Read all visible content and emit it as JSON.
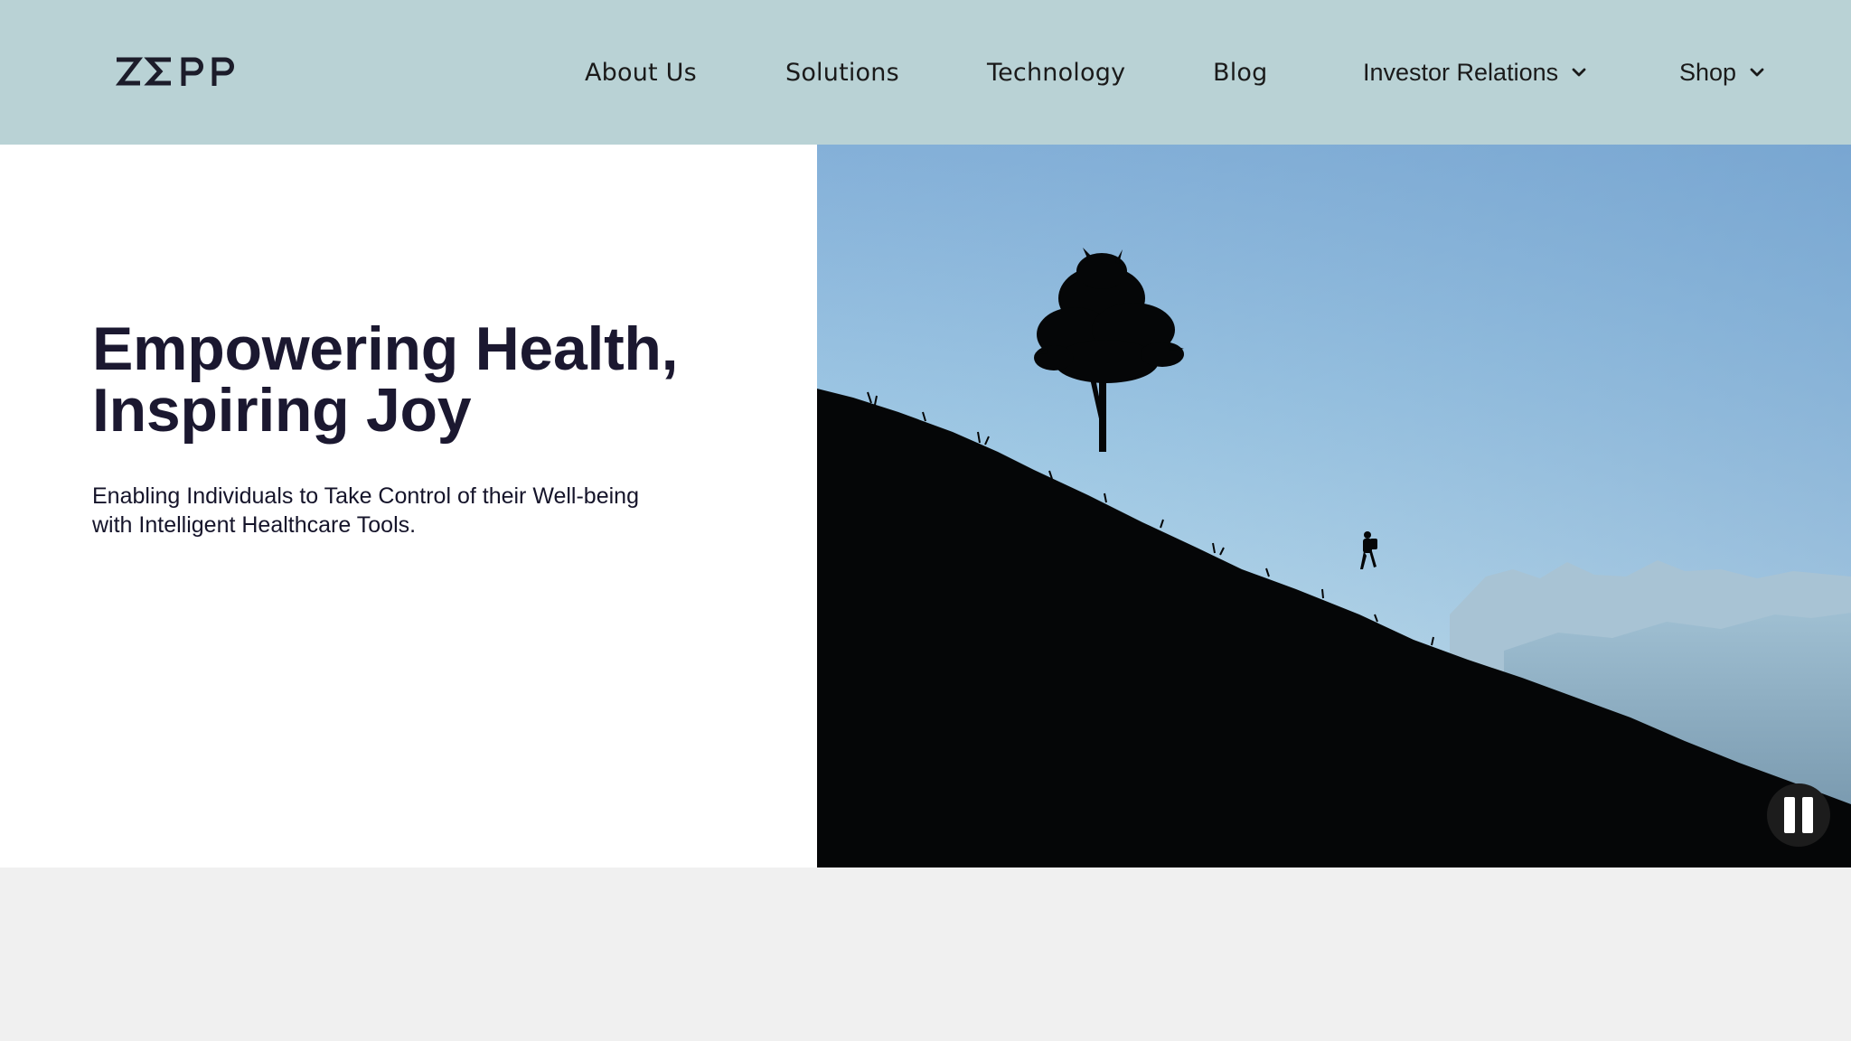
{
  "header": {
    "logo_text": "ZΣPP",
    "nav": [
      {
        "label": "About Us",
        "icon": null
      },
      {
        "label": "Solutions",
        "icon": null
      },
      {
        "label": "Technology",
        "icon": null
      },
      {
        "label": "Blog",
        "icon": null
      },
      {
        "label": "Investor Relations",
        "icon": "chevron-down-icon"
      },
      {
        "label": "Shop",
        "icon": "chevron-down-icon"
      }
    ],
    "background": "#b9d2d5"
  },
  "hero": {
    "title_line1": "Empowering Health,",
    "title_line2": "Inspiring Joy",
    "subtitle_line1": "Enabling Individuals to Take Control of their Well-being",
    "subtitle_line2": "with Intelligent Healthcare Tools.",
    "title_color": "#1b1830",
    "media": {
      "icon": "pause-icon",
      "state": "playing"
    }
  },
  "colors": {
    "page_background": "#f0f0f0",
    "hero_left_background": "#ffffff",
    "sky_top": "#7eaed9",
    "sky_bottom": "#c4e2ef",
    "silhouette": "#050607"
  }
}
